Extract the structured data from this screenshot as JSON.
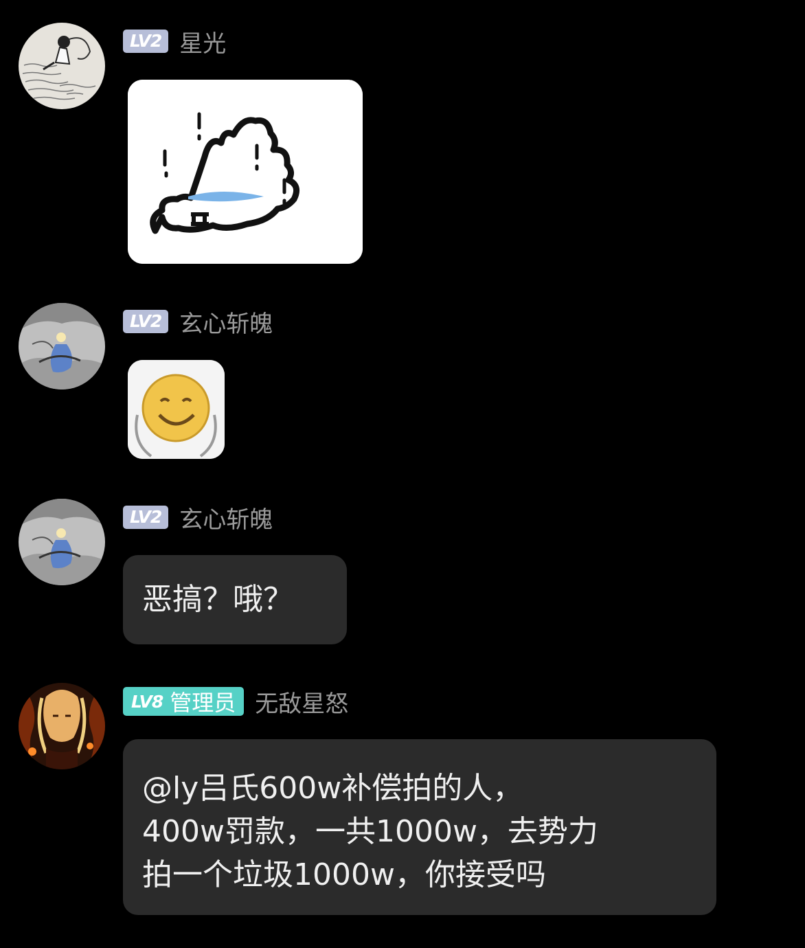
{
  "messages": [
    {
      "user": "星光",
      "level": "LV2",
      "type": "sticker",
      "sticker": "scream-ghost-sticker"
    },
    {
      "user": "玄心斩魄",
      "level": "LV2",
      "type": "sticker",
      "sticker": "smiley-face-sticker"
    },
    {
      "user": "玄心斩魄",
      "level": "LV2",
      "type": "text",
      "text": "恶搞？哦？"
    },
    {
      "user": "无敌星怒",
      "level": "LV8",
      "role": "管理员",
      "type": "text",
      "text": "@ly吕氏600w补偿拍的人，\n400w罚款，一共1000w，去势力\n拍一个垃圾1000w，你接受吗"
    }
  ],
  "colors": {
    "background": "#000000",
    "bubble": "#2b2b2b",
    "level_badge": "#b7bed8",
    "admin_badge": "#56d1c6",
    "username": "#9a9a9a"
  }
}
